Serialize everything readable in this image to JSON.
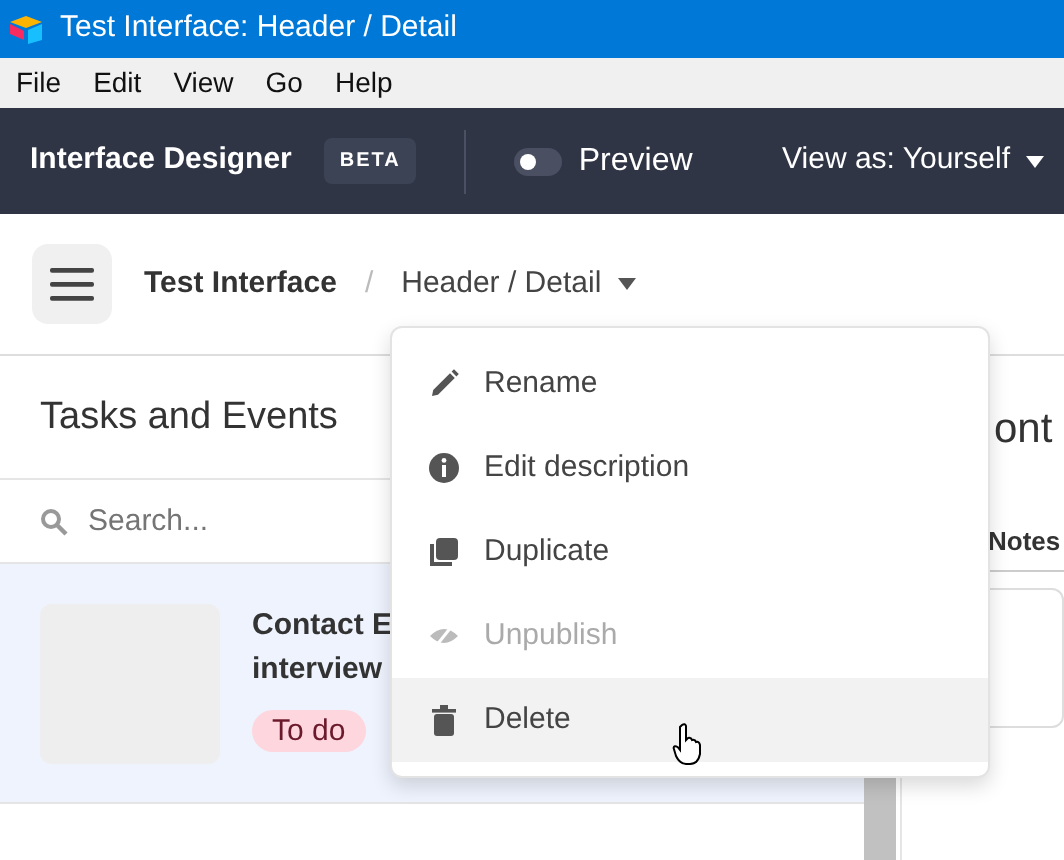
{
  "window": {
    "title": "Test Interface: Header / Detail"
  },
  "menu_bar": [
    "File",
    "Edit",
    "View",
    "Go",
    "Help"
  ],
  "header": {
    "app_name": "Interface Designer",
    "badge": "BETA",
    "preview": {
      "label": "Preview",
      "on": false
    },
    "view_as": "View as: Yourself"
  },
  "breadcrumb": {
    "items": [
      "Test Interface",
      "Header / Detail"
    ],
    "separator": "/"
  },
  "left_panel": {
    "title": "Tasks and Events",
    "search": {
      "placeholder": "Search..."
    },
    "records": [
      {
        "title_lines": [
          "Contact E",
          "interview"
        ],
        "status": "To do",
        "selected": true
      }
    ]
  },
  "right_panel": {
    "title": "ont",
    "tab": "Notes"
  },
  "dropdown_menu": {
    "items": [
      {
        "label": "Rename",
        "kind": "pencil",
        "disabled": false,
        "hovered": false
      },
      {
        "label": "Edit description",
        "kind": "info",
        "disabled": false,
        "hovered": false
      },
      {
        "label": "Duplicate",
        "kind": "copy",
        "disabled": false,
        "hovered": false
      },
      {
        "label": "Unpublish",
        "kind": "eye-off",
        "disabled": true,
        "hovered": false
      },
      {
        "label": "Delete",
        "kind": "trash",
        "disabled": false,
        "hovered": true
      }
    ]
  }
}
